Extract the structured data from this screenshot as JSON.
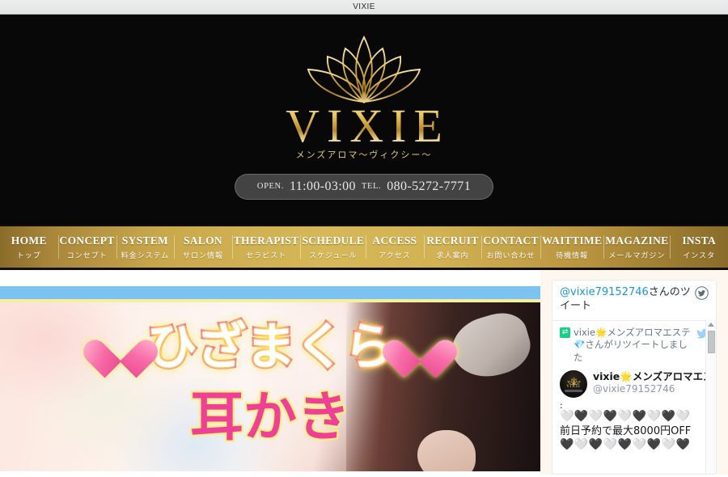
{
  "window": {
    "title": "VIXIE"
  },
  "header": {
    "logo_icon": "lotus-flower-icon",
    "brand": "VIXIE",
    "brand_subtitle": "メンズアロマ～ヴィクシー～",
    "info": {
      "open_label": "OPEN.",
      "open_value": "11:00-03:00",
      "tel_label": "TEL.",
      "tel_value": "080-5272-7771"
    },
    "colors": {
      "gold": "#d6b858",
      "background": "#080808"
    }
  },
  "nav": {
    "items": [
      {
        "en": "HOME",
        "jp": "トップ"
      },
      {
        "en": "CONCEPT",
        "jp": "コンセプト"
      },
      {
        "en": "SYSTEM",
        "jp": "料金システム"
      },
      {
        "en": "SALON",
        "jp": "サロン情報"
      },
      {
        "en": "THERAPIST",
        "jp": "セラピスト"
      },
      {
        "en": "SCHEDULE",
        "jp": "スケジュール"
      },
      {
        "en": "ACCESS",
        "jp": "アクセス"
      },
      {
        "en": "RECRUIT",
        "jp": "求人案内"
      },
      {
        "en": "CONTACT",
        "jp": "お問い合わせ"
      },
      {
        "en": "WAITTIME",
        "jp": "待機情報"
      },
      {
        "en": "MAGAZINE",
        "jp": "メールマガジン"
      },
      {
        "en": "INSTA",
        "jp": "インスタ"
      }
    ]
  },
  "banner": {
    "line1": "ひざまくら",
    "line2": "耳かき",
    "accent_color": "#ef3f96",
    "glow_color": "#fff06a",
    "top_strip_color": "#7ec2ef"
  },
  "twitter": {
    "header_handle": "@vixie79152746",
    "header_suffix": "さんのツイート",
    "bird_icon": "twitter-bird-icon",
    "retweet_icon": "retweet-icon",
    "retweet_text": "vixie🌟メンズアロマエステ💎さんがリツイートしました",
    "account": {
      "avatar_icon": "vixie-avatar-icon",
      "avatar_brand": "VIXIE",
      "display_name": "vixie🌟メンズアロマエス",
      "handle": "@vixie79152746"
    },
    "tweet": {
      "colon": ":",
      "hearts_top": "🤍🖤🤍🖤🤍🖤🤍🖤🤍",
      "text": "前日予約で最大8000円OFF",
      "hearts_bottom": "🖤🤍🖤🤍🖤🤍🖤🤍🖤"
    }
  }
}
